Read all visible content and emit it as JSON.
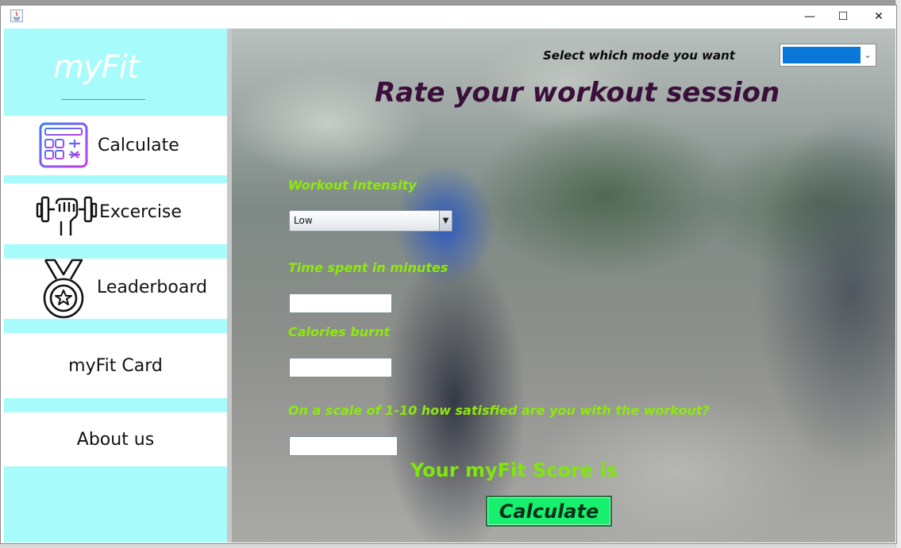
{
  "window": {
    "controls": {
      "minimize": "—",
      "maximize": "☐",
      "close": "✕"
    }
  },
  "sidebar": {
    "logo": "myFit",
    "items": [
      {
        "label": "Calculate",
        "icon": "calculator-icon"
      },
      {
        "label": "Excercise",
        "icon": "dumbbell-icon"
      },
      {
        "label": "Leaderboard",
        "icon": "medal-icon"
      },
      {
        "label": "myFit Card",
        "icon": ""
      },
      {
        "label": "About us",
        "icon": ""
      }
    ]
  },
  "main": {
    "mode_label": "Select which mode you want",
    "mode_select_caret": "⌄",
    "title": "Rate your workout session",
    "fields": {
      "intensity_label": "Workout Intensity",
      "intensity_value": "Low",
      "intensity_arrow": "▼",
      "time_label": "Time spent in minutes",
      "calories_label": "Calories burnt",
      "satisfaction_label": "On a scale of 1-10 how satisfied are you with the workout?"
    },
    "score_label": "Your myFit Score is",
    "calculate_button": "Calculate"
  },
  "colors": {
    "sidebar_bg": "#a8fbfb",
    "title": "#3a0f3a",
    "field_label": "#8ee80e",
    "score_label": "#7fe60c",
    "button_bg": "#17f06e",
    "mode_select_fill": "#0a78d8"
  }
}
